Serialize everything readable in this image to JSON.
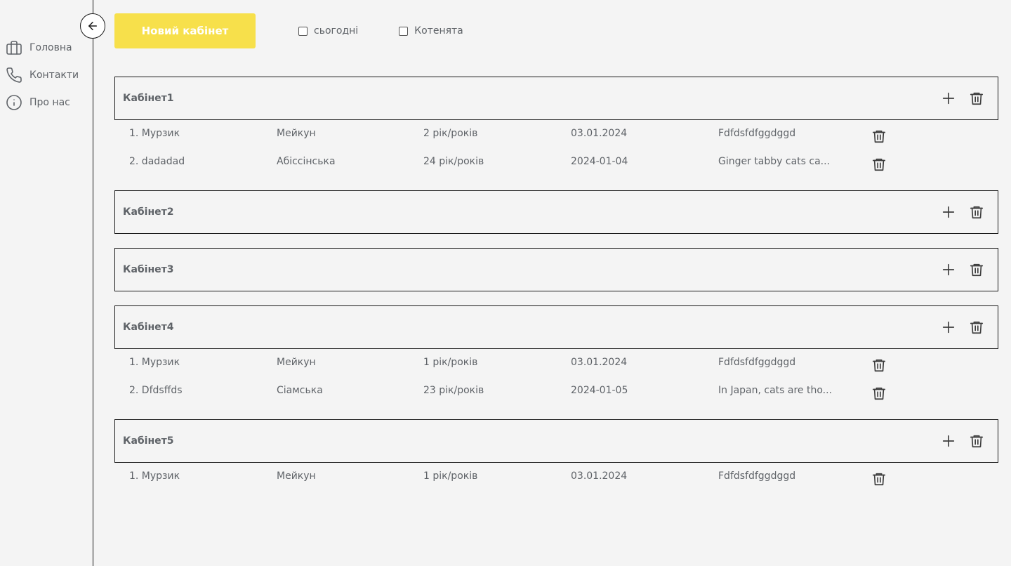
{
  "sidebar": {
    "items": [
      {
        "label": "Головна",
        "icon": "briefcase-icon"
      },
      {
        "label": "Контакти",
        "icon": "phone-icon"
      },
      {
        "label": "Про нас",
        "icon": "info-icon"
      }
    ]
  },
  "toolbar": {
    "new_cabinet_label": "Новий кабінет",
    "filters": [
      {
        "label": "сьогодні",
        "checked": false
      },
      {
        "label": "Котенята",
        "checked": false
      }
    ]
  },
  "cabinets": [
    {
      "name": "Кабінет1",
      "cats": [
        {
          "name": "1. Мурзик",
          "breed": "Мейкун",
          "age": "2 рік/років",
          "date": "03.01.2024",
          "desc": "Fdfdsfdfggdggd"
        },
        {
          "name": "2. dadadad",
          "breed": "Абіссінська",
          "age": "24 рік/років",
          "date": "2024-01-04",
          "desc": "Ginger tabby cats ca..."
        }
      ]
    },
    {
      "name": "Кабінет2",
      "cats": []
    },
    {
      "name": "Кабінет3",
      "cats": []
    },
    {
      "name": "Кабінет4",
      "cats": [
        {
          "name": "1. Мурзик",
          "breed": "Мейкун",
          "age": "1 рік/років",
          "date": "03.01.2024",
          "desc": "Fdfdsfdfggdggd"
        },
        {
          "name": "2. Dfdsffds",
          "breed": "Сіамська",
          "age": "23 рік/років",
          "date": "2024-01-05",
          "desc": "In Japan, cats are tho..."
        }
      ]
    },
    {
      "name": "Кабінет5",
      "cats": [
        {
          "name": "1. Мурзик",
          "breed": "Мейкун",
          "age": "1 рік/років",
          "date": "03.01.2024",
          "desc": "Fdfdsfdfggdggd"
        }
      ]
    }
  ],
  "colors": {
    "accent": "#f7e04b",
    "background": "#f4f4f4",
    "text": "#5f6368",
    "border": "#1a1a1a"
  }
}
